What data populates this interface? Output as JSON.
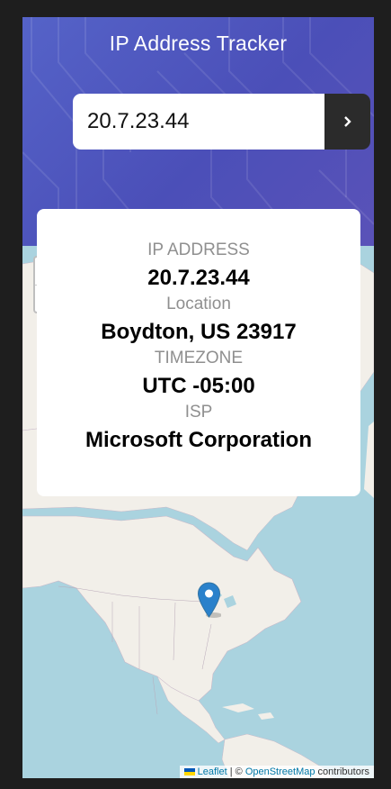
{
  "header": {
    "title": "IP Address Tracker"
  },
  "search": {
    "value": "20.7.23.44",
    "button_icon": "chevron-right-icon"
  },
  "info": {
    "ip_label": "IP ADDRESS",
    "ip_value": "20.7.23.44",
    "location_label": "Location",
    "location_value": "Boydton, US 23917",
    "timezone_label": "TIMEZONE",
    "timezone_value": "UTC -05:00",
    "isp_label": "ISP",
    "isp_value": "Microsoft Corporation"
  },
  "map": {
    "zoom_in": "+",
    "zoom_out": "−",
    "marker_icon": "map-pin-icon",
    "attribution": {
      "leaflet": "Leaflet",
      "separator": " | © ",
      "osm": "OpenStreetMap",
      "contributors": " contributors"
    }
  },
  "colors": {
    "header_bg": "#4b4fb8",
    "search_button": "#2b2b2b",
    "ocean": "#aad3df",
    "land": "#f2efe9",
    "marker": "#2a81cb"
  }
}
